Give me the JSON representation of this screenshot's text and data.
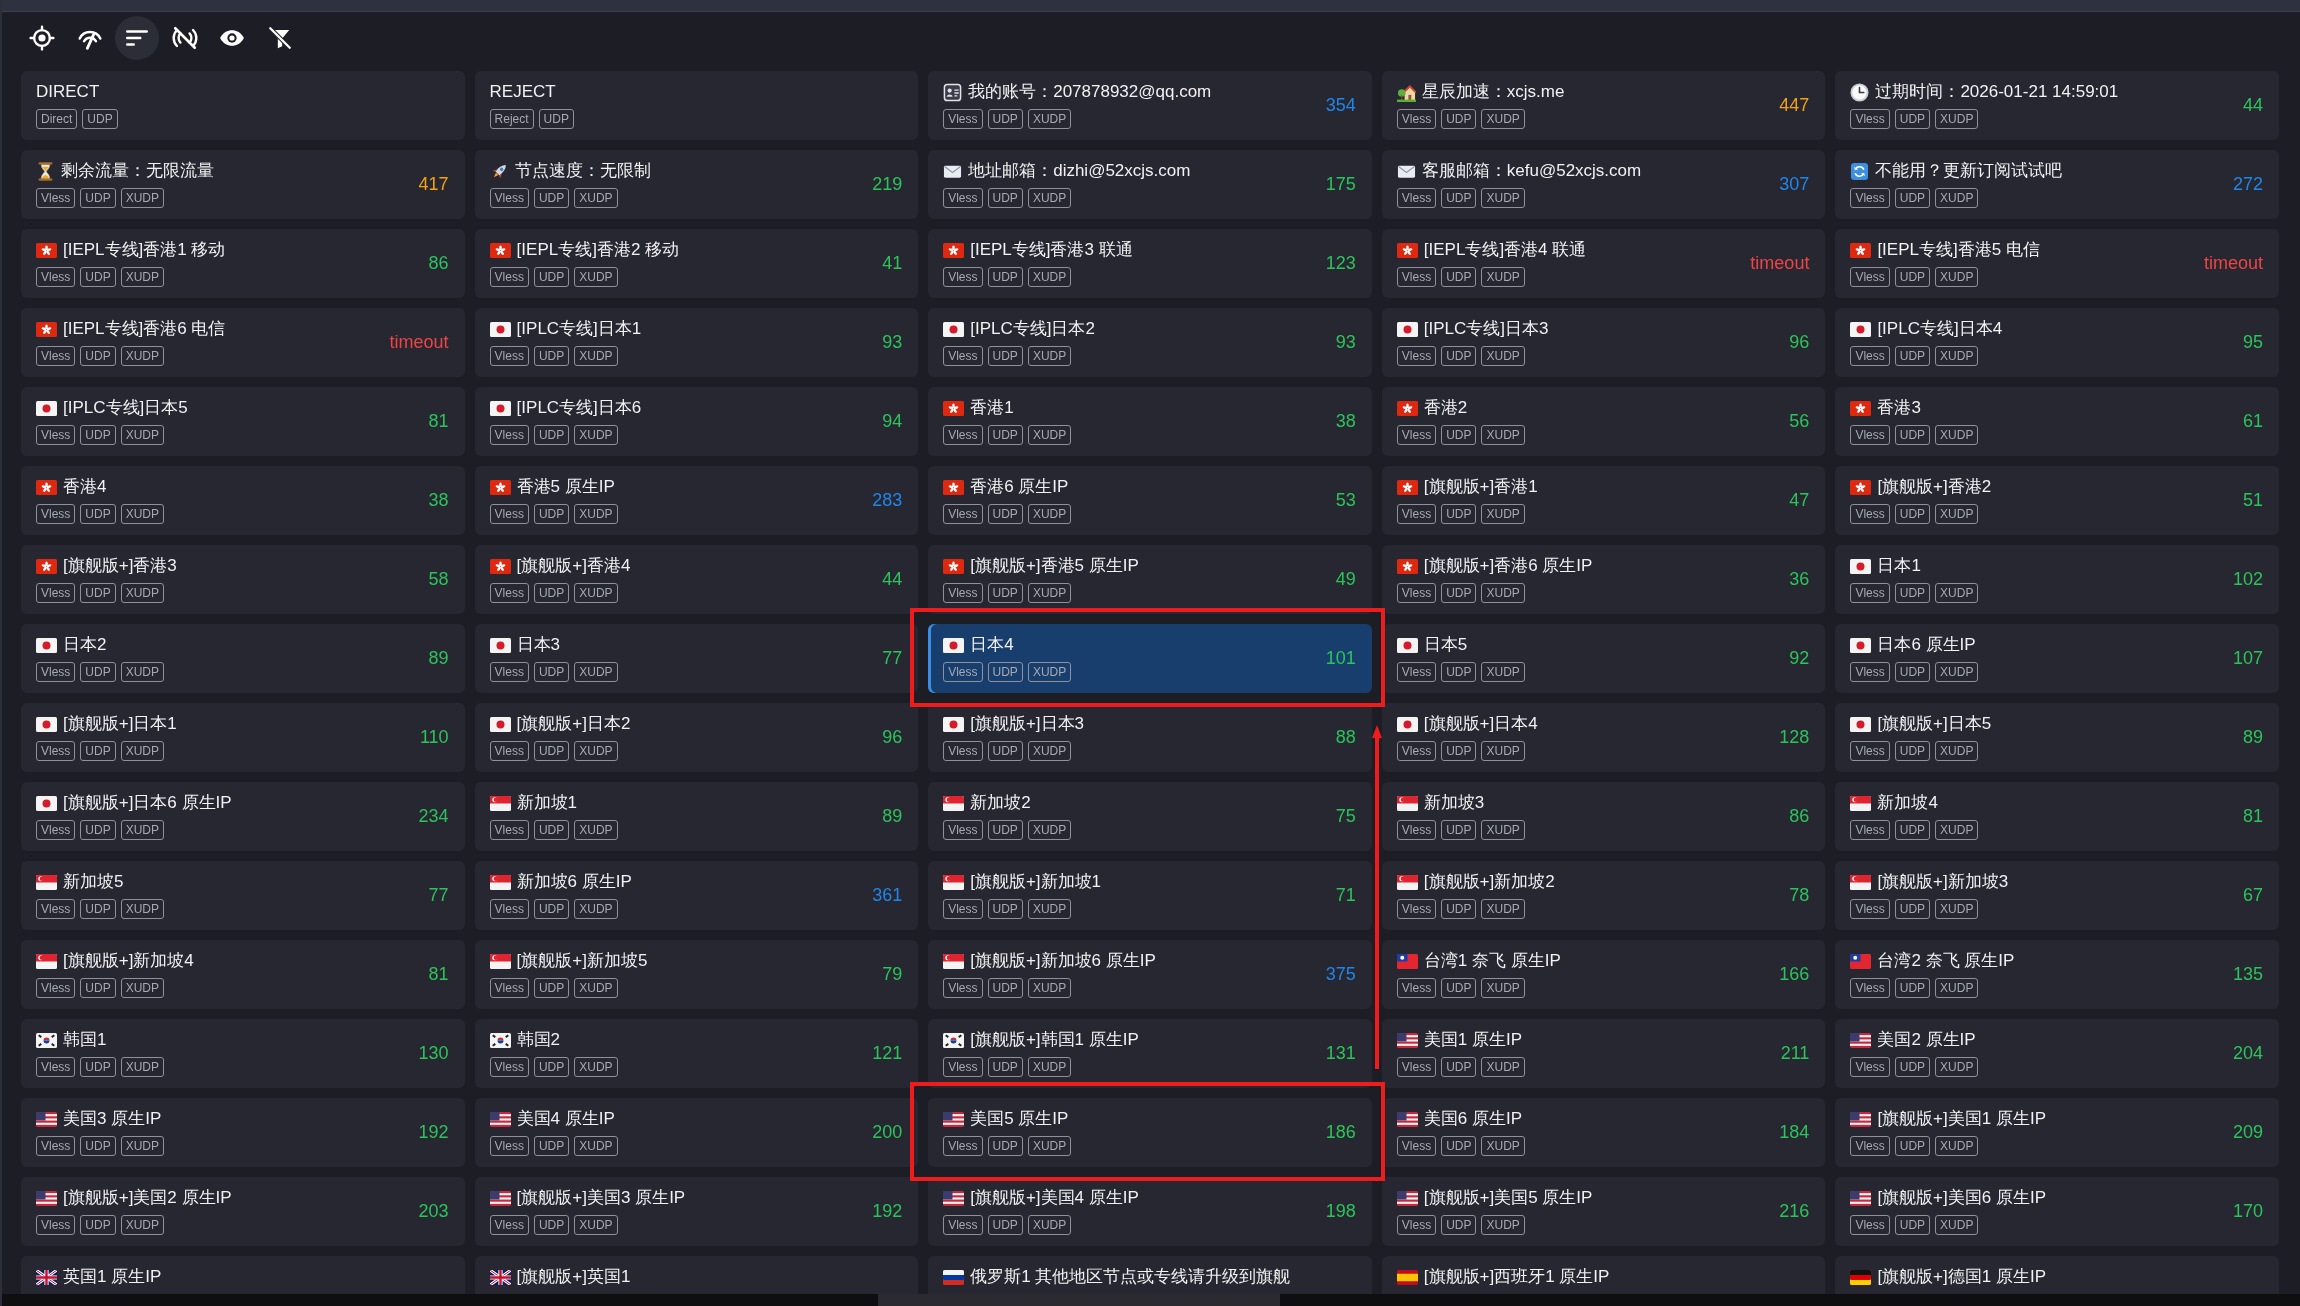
{
  "toolbar": [
    {
      "kind": "crosshair",
      "selected": false
    },
    {
      "kind": "gauge",
      "selected": false
    },
    {
      "kind": "sort",
      "selected": true
    },
    {
      "kind": "signal-off",
      "selected": false
    },
    {
      "kind": "eye",
      "selected": false
    },
    {
      "kind": "filter-off",
      "selected": false
    }
  ],
  "nodes": [
    {
      "name": "DIRECT",
      "tags": [
        "Direct",
        "UDP"
      ],
      "selected": false,
      "marked": false
    },
    {
      "name": "REJECT",
      "tags": [
        "Reject",
        "UDP"
      ],
      "selected": false,
      "marked": false
    },
    {
      "kind": "id",
      "name": "我的账号：207878932@qq.com",
      "tags": [
        "Vless",
        "UDP",
        "XUDP"
      ],
      "delay": "354",
      "color": "#2186e8",
      "selected": false,
      "marked": false
    },
    {
      "kind": "house",
      "name": "星辰加速：xcjs.me",
      "tags": [
        "Vless",
        "UDP",
        "XUDP"
      ],
      "delay": "447",
      "color": "#f5a20c",
      "selected": false,
      "marked": false
    },
    {
      "kind": "clock",
      "name": "过期时间：2026-01-21 14:59:01",
      "tags": [
        "Vless",
        "UDP",
        "XUDP"
      ],
      "delay": "44",
      "color": "#2cc45a",
      "selected": false,
      "marked": false
    },
    {
      "kind": "hourglass",
      "name": "剩余流量：无限流量",
      "tags": [
        "Vless",
        "UDP",
        "XUDP"
      ],
      "delay": "417",
      "color": "#f5a20c",
      "selected": false,
      "marked": false
    },
    {
      "kind": "rocket",
      "name": "节点速度：无限制",
      "tags": [
        "Vless",
        "UDP",
        "XUDP"
      ],
      "delay": "219",
      "color": "#2cc45a",
      "selected": false,
      "marked": false
    },
    {
      "kind": "mail",
      "name": "地址邮箱：dizhi@52xcjs.com",
      "tags": [
        "Vless",
        "UDP",
        "XUDP"
      ],
      "delay": "175",
      "color": "#2cc45a",
      "selected": false,
      "marked": false
    },
    {
      "kind": "mail",
      "name": "客服邮箱：kefu@52xcjs.com",
      "tags": [
        "Vless",
        "UDP",
        "XUDP"
      ],
      "delay": "307",
      "color": "#2186e8",
      "selected": false,
      "marked": false
    },
    {
      "kind": "refresh",
      "name": "不能用？更新订阅试试吧",
      "tags": [
        "Vless",
        "UDP",
        "XUDP"
      ],
      "delay": "272",
      "color": "#2186e8",
      "selected": false,
      "marked": false
    },
    {
      "kind": "hk",
      "name": "[IEPL专线]香港1 移动",
      "tags": [
        "Vless",
        "UDP",
        "XUDP"
      ],
      "delay": "86",
      "color": "#2cc45a",
      "selected": false,
      "marked": false
    },
    {
      "kind": "hk",
      "name": "[IEPL专线]香港2 移动",
      "tags": [
        "Vless",
        "UDP",
        "XUDP"
      ],
      "delay": "41",
      "color": "#2cc45a",
      "selected": false,
      "marked": false
    },
    {
      "kind": "hk",
      "name": "[IEPL专线]香港3 联通",
      "tags": [
        "Vless",
        "UDP",
        "XUDP"
      ],
      "delay": "123",
      "color": "#2cc45a",
      "selected": false,
      "marked": false
    },
    {
      "kind": "hk",
      "name": "[IEPL专线]香港4 联通",
      "tags": [
        "Vless",
        "UDP",
        "XUDP"
      ],
      "delay": "timeout",
      "color": "#ef4444",
      "selected": false,
      "marked": false
    },
    {
      "kind": "hk",
      "name": "[IEPL专线]香港5 电信",
      "tags": [
        "Vless",
        "UDP",
        "XUDP"
      ],
      "delay": "timeout",
      "color": "#ef4444",
      "selected": false,
      "marked": false
    },
    {
      "kind": "hk",
      "name": "[IEPL专线]香港6 电信",
      "tags": [
        "Vless",
        "UDP",
        "XUDP"
      ],
      "delay": "timeout",
      "color": "#ef4444",
      "selected": false,
      "marked": false
    },
    {
      "kind": "jp",
      "name": "[IPLC专线]日本1",
      "tags": [
        "Vless",
        "UDP",
        "XUDP"
      ],
      "delay": "93",
      "color": "#2cc45a",
      "selected": false,
      "marked": false
    },
    {
      "kind": "jp",
      "name": "[IPLC专线]日本2",
      "tags": [
        "Vless",
        "UDP",
        "XUDP"
      ],
      "delay": "93",
      "color": "#2cc45a",
      "selected": false,
      "marked": false
    },
    {
      "kind": "jp",
      "name": "[IPLC专线]日本3",
      "tags": [
        "Vless",
        "UDP",
        "XUDP"
      ],
      "delay": "96",
      "color": "#2cc45a",
      "selected": false,
      "marked": false
    },
    {
      "kind": "jp",
      "name": "[IPLC专线]日本4",
      "tags": [
        "Vless",
        "UDP",
        "XUDP"
      ],
      "delay": "95",
      "color": "#2cc45a",
      "selected": false,
      "marked": false
    },
    {
      "kind": "jp",
      "name": "[IPLC专线]日本5",
      "tags": [
        "Vless",
        "UDP",
        "XUDP"
      ],
      "delay": "81",
      "color": "#2cc45a",
      "selected": false,
      "marked": false
    },
    {
      "kind": "jp",
      "name": "[IPLC专线]日本6",
      "tags": [
        "Vless",
        "UDP",
        "XUDP"
      ],
      "delay": "94",
      "color": "#2cc45a",
      "selected": false,
      "marked": false
    },
    {
      "kind": "hk",
      "name": "香港1",
      "tags": [
        "Vless",
        "UDP",
        "XUDP"
      ],
      "delay": "38",
      "color": "#2cc45a",
      "selected": false,
      "marked": false
    },
    {
      "kind": "hk",
      "name": "香港2",
      "tags": [
        "Vless",
        "UDP",
        "XUDP"
      ],
      "delay": "56",
      "color": "#2cc45a",
      "selected": false,
      "marked": false
    },
    {
      "kind": "hk",
      "name": "香港3",
      "tags": [
        "Vless",
        "UDP",
        "XUDP"
      ],
      "delay": "61",
      "color": "#2cc45a",
      "selected": false,
      "marked": false
    },
    {
      "kind": "hk",
      "name": "香港4",
      "tags": [
        "Vless",
        "UDP",
        "XUDP"
      ],
      "delay": "38",
      "color": "#2cc45a",
      "selected": false,
      "marked": false
    },
    {
      "kind": "hk",
      "name": "香港5 原生IP",
      "tags": [
        "Vless",
        "UDP",
        "XUDP"
      ],
      "delay": "283",
      "color": "#2186e8",
      "selected": false,
      "marked": false
    },
    {
      "kind": "hk",
      "name": "香港6 原生IP",
      "tags": [
        "Vless",
        "UDP",
        "XUDP"
      ],
      "delay": "53",
      "color": "#2cc45a",
      "selected": false,
      "marked": false
    },
    {
      "kind": "hk",
      "name": "[旗舰版+]香港1",
      "tags": [
        "Vless",
        "UDP",
        "XUDP"
      ],
      "delay": "47",
      "color": "#2cc45a",
      "selected": false,
      "marked": false
    },
    {
      "kind": "hk",
      "name": "[旗舰版+]香港2",
      "tags": [
        "Vless",
        "UDP",
        "XUDP"
      ],
      "delay": "51",
      "color": "#2cc45a",
      "selected": false,
      "marked": false
    },
    {
      "kind": "hk",
      "name": "[旗舰版+]香港3",
      "tags": [
        "Vless",
        "UDP",
        "XUDP"
      ],
      "delay": "58",
      "color": "#2cc45a",
      "selected": false,
      "marked": false
    },
    {
      "kind": "hk",
      "name": "[旗舰版+]香港4",
      "tags": [
        "Vless",
        "UDP",
        "XUDP"
      ],
      "delay": "44",
      "color": "#2cc45a",
      "selected": false,
      "marked": false
    },
    {
      "kind": "hk",
      "name": "[旗舰版+]香港5 原生IP",
      "tags": [
        "Vless",
        "UDP",
        "XUDP"
      ],
      "delay": "49",
      "color": "#2cc45a",
      "selected": false,
      "marked": false
    },
    {
      "kind": "hk",
      "name": "[旗舰版+]香港6 原生IP",
      "tags": [
        "Vless",
        "UDP",
        "XUDP"
      ],
      "delay": "36",
      "color": "#2cc45a",
      "selected": false,
      "marked": false
    },
    {
      "kind": "jp",
      "name": "日本1",
      "tags": [
        "Vless",
        "UDP",
        "XUDP"
      ],
      "delay": "102",
      "color": "#2cc45a",
      "selected": false,
      "marked": false
    },
    {
      "kind": "jp",
      "name": "日本2",
      "tags": [
        "Vless",
        "UDP",
        "XUDP"
      ],
      "delay": "89",
      "color": "#2cc45a",
      "selected": false,
      "marked": false
    },
    {
      "kind": "jp",
      "name": "日本3",
      "tags": [
        "Vless",
        "UDP",
        "XUDP"
      ],
      "delay": "77",
      "color": "#2cc45a",
      "selected": false,
      "marked": false
    },
    {
      "kind": "jp",
      "name": "日本4",
      "tags": [
        "Vless",
        "UDP",
        "XUDP"
      ],
      "delay": "101",
      "color": "#2cc45a",
      "selected": true,
      "marked": true
    },
    {
      "kind": "jp",
      "name": "日本5",
      "tags": [
        "Vless",
        "UDP",
        "XUDP"
      ],
      "delay": "92",
      "color": "#2cc45a",
      "selected": false,
      "marked": false
    },
    {
      "kind": "jp",
      "name": "日本6 原生IP",
      "tags": [
        "Vless",
        "UDP",
        "XUDP"
      ],
      "delay": "107",
      "color": "#2cc45a",
      "selected": false,
      "marked": false
    },
    {
      "kind": "jp",
      "name": "[旗舰版+]日本1",
      "tags": [
        "Vless",
        "UDP",
        "XUDP"
      ],
      "delay": "110",
      "color": "#2cc45a",
      "selected": false,
      "marked": false
    },
    {
      "kind": "jp",
      "name": "[旗舰版+]日本2",
      "tags": [
        "Vless",
        "UDP",
        "XUDP"
      ],
      "delay": "96",
      "color": "#2cc45a",
      "selected": false,
      "marked": false
    },
    {
      "kind": "jp",
      "name": "[旗舰版+]日本3",
      "tags": [
        "Vless",
        "UDP",
        "XUDP"
      ],
      "delay": "88",
      "color": "#2cc45a",
      "selected": false,
      "marked": false
    },
    {
      "kind": "jp",
      "name": "[旗舰版+]日本4",
      "tags": [
        "Vless",
        "UDP",
        "XUDP"
      ],
      "delay": "128",
      "color": "#2cc45a",
      "selected": false,
      "marked": false
    },
    {
      "kind": "jp",
      "name": "[旗舰版+]日本5",
      "tags": [
        "Vless",
        "UDP",
        "XUDP"
      ],
      "delay": "89",
      "color": "#2cc45a",
      "selected": false,
      "marked": false
    },
    {
      "kind": "jp",
      "name": "[旗舰版+]日本6 原生IP",
      "tags": [
        "Vless",
        "UDP",
        "XUDP"
      ],
      "delay": "234",
      "color": "#2cc45a",
      "selected": false,
      "marked": false
    },
    {
      "kind": "sg",
      "name": "新加坡1",
      "tags": [
        "Vless",
        "UDP",
        "XUDP"
      ],
      "delay": "89",
      "color": "#2cc45a",
      "selected": false,
      "marked": false
    },
    {
      "kind": "sg",
      "name": "新加坡2",
      "tags": [
        "Vless",
        "UDP",
        "XUDP"
      ],
      "delay": "75",
      "color": "#2cc45a",
      "selected": false,
      "marked": false
    },
    {
      "kind": "sg",
      "name": "新加坡3",
      "tags": [
        "Vless",
        "UDP",
        "XUDP"
      ],
      "delay": "86",
      "color": "#2cc45a",
      "selected": false,
      "marked": false
    },
    {
      "kind": "sg",
      "name": "新加坡4",
      "tags": [
        "Vless",
        "UDP",
        "XUDP"
      ],
      "delay": "81",
      "color": "#2cc45a",
      "selected": false,
      "marked": false
    },
    {
      "kind": "sg",
      "name": "新加坡5",
      "tags": [
        "Vless",
        "UDP",
        "XUDP"
      ],
      "delay": "77",
      "color": "#2cc45a",
      "selected": false,
      "marked": false
    },
    {
      "kind": "sg",
      "name": "新加坡6 原生IP",
      "tags": [
        "Vless",
        "UDP",
        "XUDP"
      ],
      "delay": "361",
      "color": "#2186e8",
      "selected": false,
      "marked": false
    },
    {
      "kind": "sg",
      "name": "[旗舰版+]新加坡1",
      "tags": [
        "Vless",
        "UDP",
        "XUDP"
      ],
      "delay": "71",
      "color": "#2cc45a",
      "selected": false,
      "marked": false
    },
    {
      "kind": "sg",
      "name": "[旗舰版+]新加坡2",
      "tags": [
        "Vless",
        "UDP",
        "XUDP"
      ],
      "delay": "78",
      "color": "#2cc45a",
      "selected": false,
      "marked": false
    },
    {
      "kind": "sg",
      "name": "[旗舰版+]新加坡3",
      "tags": [
        "Vless",
        "UDP",
        "XUDP"
      ],
      "delay": "67",
      "color": "#2cc45a",
      "selected": false,
      "marked": false
    },
    {
      "kind": "sg",
      "name": "[旗舰版+]新加坡4",
      "tags": [
        "Vless",
        "UDP",
        "XUDP"
      ],
      "delay": "81",
      "color": "#2cc45a",
      "selected": false,
      "marked": false
    },
    {
      "kind": "sg",
      "name": "[旗舰版+]新加坡5",
      "tags": [
        "Vless",
        "UDP",
        "XUDP"
      ],
      "delay": "79",
      "color": "#2cc45a",
      "selected": false,
      "marked": false
    },
    {
      "kind": "sg",
      "name": "[旗舰版+]新加坡6 原生IP",
      "tags": [
        "Vless",
        "UDP",
        "XUDP"
      ],
      "delay": "375",
      "color": "#2186e8",
      "selected": false,
      "marked": false
    },
    {
      "kind": "tw",
      "name": "台湾1 奈飞 原生IP",
      "tags": [
        "Vless",
        "UDP",
        "XUDP"
      ],
      "delay": "166",
      "color": "#2cc45a",
      "selected": false,
      "marked": false
    },
    {
      "kind": "tw",
      "name": "台湾2 奈飞 原生IP",
      "tags": [
        "Vless",
        "UDP",
        "XUDP"
      ],
      "delay": "135",
      "color": "#2cc45a",
      "selected": false,
      "marked": false
    },
    {
      "kind": "kr",
      "name": "韩国1",
      "tags": [
        "Vless",
        "UDP",
        "XUDP"
      ],
      "delay": "130",
      "color": "#2cc45a",
      "selected": false,
      "marked": false
    },
    {
      "kind": "kr",
      "name": "韩国2",
      "tags": [
        "Vless",
        "UDP",
        "XUDP"
      ],
      "delay": "121",
      "color": "#2cc45a",
      "selected": false,
      "marked": false
    },
    {
      "kind": "kr",
      "name": "[旗舰版+]韩国1 原生IP",
      "tags": [
        "Vless",
        "UDP",
        "XUDP"
      ],
      "delay": "131",
      "color": "#2cc45a",
      "selected": false,
      "marked": false
    },
    {
      "kind": "us",
      "name": "美国1 原生IP",
      "tags": [
        "Vless",
        "UDP",
        "XUDP"
      ],
      "delay": "211",
      "color": "#2cc45a",
      "selected": false,
      "marked": false
    },
    {
      "kind": "us",
      "name": "美国2 原生IP",
      "tags": [
        "Vless",
        "UDP",
        "XUDP"
      ],
      "delay": "204",
      "color": "#2cc45a",
      "selected": false,
      "marked": false
    },
    {
      "kind": "us",
      "name": "美国3 原生IP",
      "tags": [
        "Vless",
        "UDP",
        "XUDP"
      ],
      "delay": "192",
      "color": "#2cc45a",
      "selected": false,
      "marked": false
    },
    {
      "kind": "us",
      "name": "美国4 原生IP",
      "tags": [
        "Vless",
        "UDP",
        "XUDP"
      ],
      "delay": "200",
      "color": "#2cc45a",
      "selected": false,
      "marked": false
    },
    {
      "kind": "us",
      "name": "美国5 原生IP",
      "tags": [
        "Vless",
        "UDP",
        "XUDP"
      ],
      "delay": "186",
      "color": "#2cc45a",
      "selected": false,
      "marked": true
    },
    {
      "kind": "us",
      "name": "美国6 原生IP",
      "tags": [
        "Vless",
        "UDP",
        "XUDP"
      ],
      "delay": "184",
      "color": "#2cc45a",
      "selected": false,
      "marked": false
    },
    {
      "kind": "us",
      "name": "[旗舰版+]美国1 原生IP",
      "tags": [
        "Vless",
        "UDP",
        "XUDP"
      ],
      "delay": "209",
      "color": "#2cc45a",
      "selected": false,
      "marked": false
    },
    {
      "kind": "us",
      "name": "[旗舰版+]美国2 原生IP",
      "tags": [
        "Vless",
        "UDP",
        "XUDP"
      ],
      "delay": "203",
      "color": "#2cc45a",
      "selected": false,
      "marked": false
    },
    {
      "kind": "us",
      "name": "[旗舰版+]美国3 原生IP",
      "tags": [
        "Vless",
        "UDP",
        "XUDP"
      ],
      "delay": "192",
      "color": "#2cc45a",
      "selected": false,
      "marked": false
    },
    {
      "kind": "us",
      "name": "[旗舰版+]美国4 原生IP",
      "tags": [
        "Vless",
        "UDP",
        "XUDP"
      ],
      "delay": "198",
      "color": "#2cc45a",
      "selected": false,
      "marked": false
    },
    {
      "kind": "us",
      "name": "[旗舰版+]美国5 原生IP",
      "tags": [
        "Vless",
        "UDP",
        "XUDP"
      ],
      "delay": "216",
      "color": "#2cc45a",
      "selected": false,
      "marked": false
    },
    {
      "kind": "us",
      "name": "[旗舰版+]美国6 原生IP",
      "tags": [
        "Vless",
        "UDP",
        "XUDP"
      ],
      "delay": "170",
      "color": "#2cc45a",
      "selected": false,
      "marked": false
    },
    {
      "kind": "gb",
      "name": "英国1 原生IP",
      "selected": false,
      "marked": false
    },
    {
      "kind": "gb",
      "name": "[旗舰版+]英国1",
      "selected": false,
      "marked": false
    },
    {
      "kind": "ru",
      "name": "俄罗斯1 其他地区节点或专线请升级到旗舰",
      "selected": false,
      "marked": false
    },
    {
      "kind": "es",
      "name": "[旗舰版+]西班牙1 原生IP",
      "selected": false,
      "marked": false
    },
    {
      "kind": "de",
      "name": "[旗舰版+]德国1 原生IP",
      "selected": false,
      "marked": false
    }
  ],
  "annotation": {
    "arrow": true
  }
}
